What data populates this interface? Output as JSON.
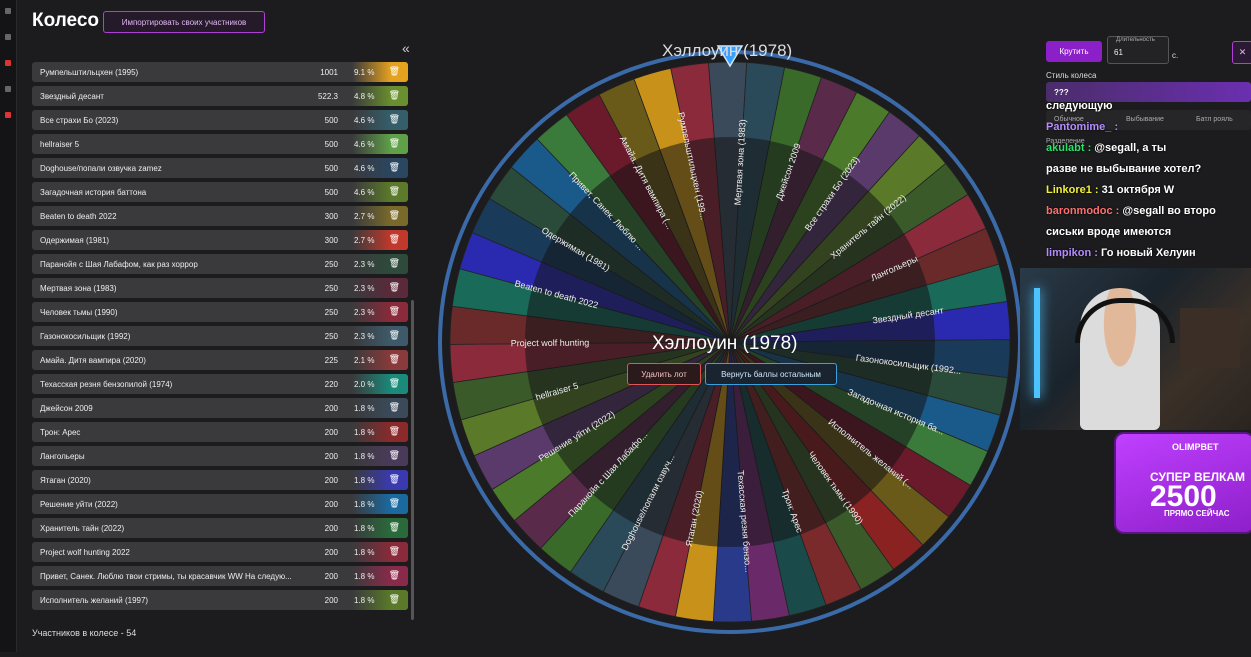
{
  "header": {
    "title": "Колесо",
    "import_button": "Импортировать своих участников",
    "collapse_icon": "«"
  },
  "items": [
    {
      "name": "Румпельштильцхен (1995)",
      "score": "1001",
      "pct": "9.1 %",
      "color": "#e5a21f"
    },
    {
      "name": "Звездный десант",
      "score": "522.3",
      "pct": "4.8 %",
      "color": "#6a8f2e"
    },
    {
      "name": "Все страхи Бо (2023)",
      "score": "500",
      "pct": "4.6 %",
      "color": "#355e6a"
    },
    {
      "name": "hellraiser 5",
      "score": "500",
      "pct": "4.6 %",
      "color": "#5fa048"
    },
    {
      "name": "Doghouse/попали озвучка zamez",
      "score": "500",
      "pct": "4.6 %",
      "color": "#2a4660"
    },
    {
      "name": "Загадочная история баттона",
      "score": "500",
      "pct": "4.6 %",
      "color": "#5c7a2a"
    },
    {
      "name": "Beaten to death 2022",
      "score": "300",
      "pct": "2.7 %",
      "color": "#7a6a2a"
    },
    {
      "name": "Одержимая (1981)",
      "score": "300",
      "pct": "2.7 %",
      "color": "#c0392b"
    },
    {
      "name": "Паранойя с Шая Лабафом, как раз хоррор",
      "score": "250",
      "pct": "2.3 %",
      "color": "#2e4a3a"
    },
    {
      "name": "Мертвая зона (1983)",
      "score": "250",
      "pct": "2.3 %",
      "color": "#5a2a3a"
    },
    {
      "name": "Человек тьмы (1990)",
      "score": "250",
      "pct": "2.3 %",
      "color": "#8a2a3a"
    },
    {
      "name": "Газонокосильщик (1992)",
      "score": "250",
      "pct": "2.3 %",
      "color": "#3e5a6a"
    },
    {
      "name": "Амайа. Дитя вампира (2020)",
      "score": "225",
      "pct": "2.1 %",
      "color": "#8a3a3a"
    },
    {
      "name": "Техасская резня бензопилой (1974)",
      "score": "220",
      "pct": "2.0 %",
      "color": "#1a8a7a"
    },
    {
      "name": "Джейсон 2009",
      "score": "200",
      "pct": "1.8 %",
      "color": "#3a4a5a"
    },
    {
      "name": "Трон: Арес",
      "score": "200",
      "pct": "1.8 %",
      "color": "#8a2a2a"
    },
    {
      "name": "Лангольеры",
      "score": "200",
      "pct": "1.8 %",
      "color": "#4a3a5a"
    },
    {
      "name": "Ятаган (2020)",
      "score": "200",
      "pct": "1.8 %",
      "color": "#3a3ab0"
    },
    {
      "name": "Решение уйти (2022)",
      "score": "200",
      "pct": "1.8 %",
      "color": "#1a6aa0"
    },
    {
      "name": "Хранитель тайн (2022)",
      "score": "200",
      "pct": "1.8 %",
      "color": "#2a6a3a"
    },
    {
      "name": "Project wolf hunting 2022",
      "score": "200",
      "pct": "1.8 %",
      "color": "#8a2a3a"
    },
    {
      "name": "Привет, Санек. Люблю твои стримы, ты красавчик WW На следую...",
      "score": "200",
      "pct": "1.8 %",
      "color": "#8a2a4a"
    },
    {
      "name": "Исполнитель желаний (1997)",
      "score": "200",
      "pct": "1.8 %",
      "color": "#5a7a2a"
    }
  ],
  "icons": {
    "row_icon": "trash-icon",
    "collapse": "double-chevron-left-icon",
    "close": "close-icon"
  },
  "footer": {
    "participants": "Участников в колесе - 54"
  },
  "wheel": {
    "top_title": "Хэллоуин (1978)",
    "center_title": "Хэллоуин (1978)",
    "delete_button": "Удалить лот",
    "return_button": "Вернуть баллы остальным",
    "labels": [
      {
        "text": "Румпельштильцхен (199..."
      },
      {
        "text": "Мертвая зона (1983)"
      },
      {
        "text": "Джейсон 2009"
      },
      {
        "text": "Все страхи Бо (2023)"
      },
      {
        "text": "Хранитель тайн (2022)"
      },
      {
        "text": "Лангольеры"
      },
      {
        "text": "Звездный десант"
      },
      {
        "text": "Газонокосильщик (1992..."
      },
      {
        "text": "Загадочная история ба..."
      },
      {
        "text": "Исполнитель желаний (..."
      },
      {
        "text": "Человек тьмы (1990)"
      },
      {
        "text": "Трон: Арес"
      },
      {
        "text": "Техасская резня бензо..."
      },
      {
        "text": "Ятаган (2020)"
      },
      {
        "text": "Doghouse/попали озвуч..."
      },
      {
        "text": "Паранойя с Шая Лабафо..."
      },
      {
        "text": "Решение уйти (2022)"
      },
      {
        "text": "hellraiser 5"
      },
      {
        "text": "Project wolf hunting"
      },
      {
        "text": "Beaten to death 2022"
      },
      {
        "text": "Одержимая (1981)"
      },
      {
        "text": "Привет, Санек. Люблю ..."
      },
      {
        "text": "Амайа. Дитя вампира (..."
      }
    ],
    "segment_colors": [
      "#c8921a",
      "#8a2a3a",
      "#3a4a5a",
      "#2a4a5a",
      "#3a6a2a",
      "#5a2a4a",
      "#4a7a2a",
      "#5a3a6a",
      "#5a7a2a",
      "#3a5a2a",
      "#8a2a3a",
      "#6a2a2a",
      "#1a6a5a",
      "#2a2ab0",
      "#1a3a5a",
      "#2a4a3a",
      "#1a5a8a",
      "#3a7a3a",
      "#6a1a2a",
      "#6a5a1a",
      "#8a2222",
      "#3a5a2a",
      "#7a2a2a",
      "#1a4a4a",
      "#6a2a6a",
      "#2a3a8a"
    ]
  },
  "controls": {
    "spin_button": "Крутить",
    "duration_label": "Длительность",
    "duration_value": "61",
    "duration_unit": "с.",
    "close_button": "✕",
    "style_label": "Стиль колеса",
    "style_value": "???",
    "mode_tabs": [
      "Обычное",
      "Выбывание",
      "Батл рояль"
    ],
    "division_label": "Разделение"
  },
  "chat": [
    {
      "user": "",
      "text": "следующую"
    },
    {
      "user": "Pantomime_ :",
      "text": ""
    },
    {
      "user": "akulabt :",
      "text": "@segall, а ты"
    },
    {
      "user": "",
      "text": "разве не выбывание хотел?"
    },
    {
      "user": "Linkore1 :",
      "text": "31 октября W"
    },
    {
      "user": "baronmodoc :",
      "text": "@segall во второ"
    },
    {
      "user": "",
      "text": "сиськи вроде имеются"
    },
    {
      "user": "limpikon :",
      "text": "Го новый Хелуин"
    }
  ],
  "ad": {
    "brand": "OLIMPBET",
    "line1": "СУПЕР ВЕЛКАМ",
    "line2": "2500",
    "line3": "ПРЯМО СЕЙЧАС"
  }
}
